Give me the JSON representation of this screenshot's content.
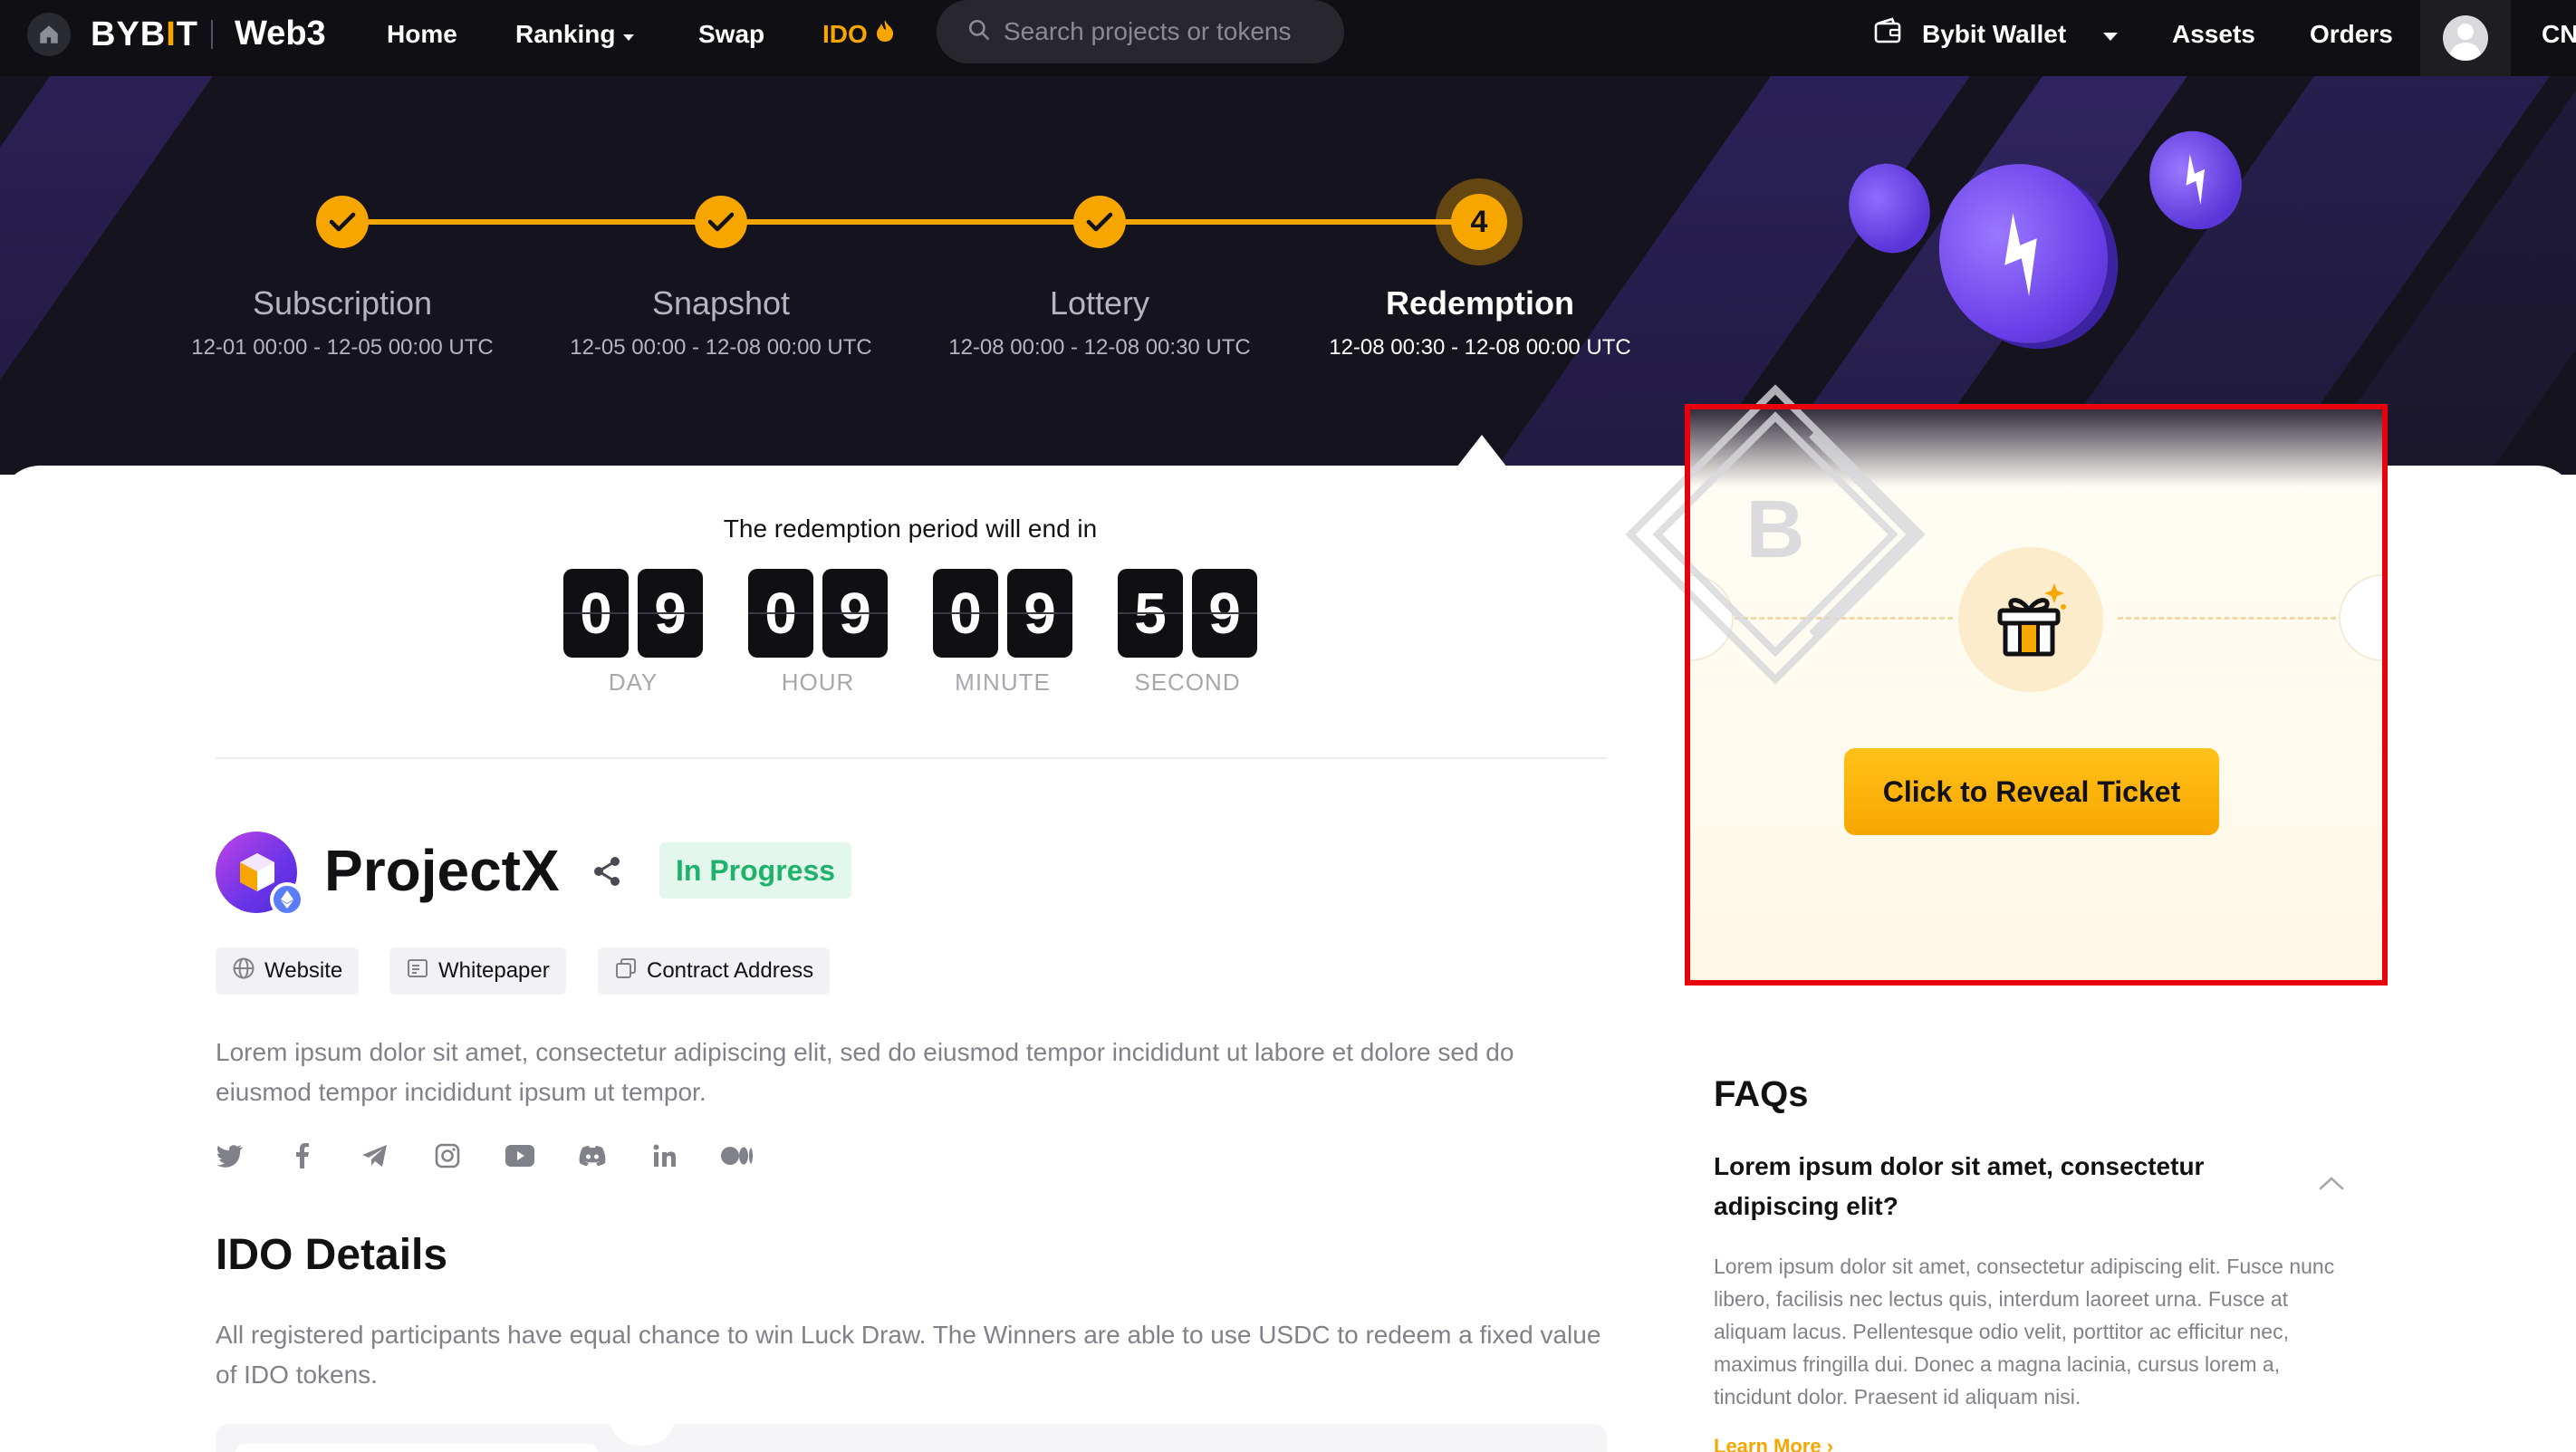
{
  "nav": {
    "brand": "BYBIT",
    "brand_sub": "Web3",
    "items": [
      {
        "label": "Home"
      },
      {
        "label": "Ranking"
      },
      {
        "label": "Swap"
      },
      {
        "label": "IDO"
      }
    ],
    "search_placeholder": "Search projects or tokens",
    "wallet_label": "Bybit Wallet",
    "assets_label": "Assets",
    "orders_label": "Orders",
    "lang_label": "CN",
    "icons": [
      "home-icon",
      "search-icon",
      "wallet-icon",
      "caret-down-icon",
      "fire-icon",
      "avatar-icon"
    ]
  },
  "steps": [
    {
      "title": "Subscription",
      "date": "12-01 00:00 - 12-05 00:00 UTC",
      "state": "done"
    },
    {
      "title": "Snapshot",
      "date": "12-05 00:00 - 12-08 00:00 UTC",
      "state": "done"
    },
    {
      "title": "Lottery",
      "date": "12-08 00:00 - 12-08 00:30 UTC",
      "state": "done"
    },
    {
      "title": "Redemption",
      "date": "12-08 00:30 - 12-08 00:00 UTC",
      "state": "current",
      "number": "4"
    }
  ],
  "countdown": {
    "label": "The redemption period will end in",
    "units": [
      {
        "digits": [
          "0",
          "9"
        ],
        "label": "DAY"
      },
      {
        "digits": [
          "0",
          "9"
        ],
        "label": "HOUR"
      },
      {
        "digits": [
          "0",
          "9"
        ],
        "label": "MINUTE"
      },
      {
        "digits": [
          "5",
          "9"
        ],
        "label": "SECOND"
      }
    ]
  },
  "project": {
    "name": "ProjectX",
    "status": "In Progress",
    "links": [
      "Website",
      "Whitepaper",
      "Contract Address"
    ],
    "description": "Lorem ipsum dolor sit amet, consectetur adipiscing elit, sed do eiusmod tempor incididunt ut labore et dolore sed do eiusmod tempor incididunt ipsum ut tempor.",
    "socials": [
      "twitter-icon",
      "facebook-icon",
      "telegram-icon",
      "instagram-icon",
      "youtube-icon",
      "discord-icon",
      "linkedin-icon",
      "medium-icon"
    ]
  },
  "ido": {
    "title": "IDO Details",
    "description": "All registered participants have equal chance to win Luck Draw. The Winners are able to use USDC to redeem a fixed value of IDO tokens."
  },
  "ticket": {
    "button_label": "Click to Reveal Ticket",
    "icon": "gift-icon",
    "watermark_letter": "B"
  },
  "faq": {
    "title": "FAQs",
    "question": "Lorem ipsum dolor sit amet, consectetur adipiscing elit?",
    "answer": "Lorem ipsum dolor sit amet, consectetur adipiscing elit. Fusce nunc libero, facilisis nec lectus quis, interdum laoreet urna. Fusce at aliquam lacus. Pellentesque odio velit, porttitor ac efficitur nec, maximus fringilla dui. Donec a magna lacinia, cursus lorem a, tincidunt dolor. Praesent id aliquam nisi.",
    "more_label": "Learn More"
  },
  "colors": {
    "accent": "#f7a600",
    "success": "#20b26c",
    "highlight": "#e8000c",
    "nav_bg": "#101014"
  }
}
